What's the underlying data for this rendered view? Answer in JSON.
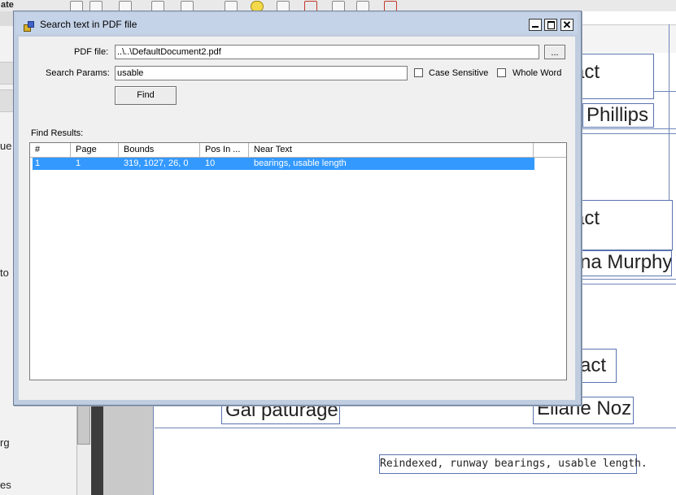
{
  "background": {
    "menu_fragment": "ate",
    "side_texts": [
      "ue",
      "to",
      "rg",
      "es"
    ],
    "cells": {
      "contact_1": "act",
      "name_1": "Phillips",
      "contact_2": "act",
      "name_2": "na Murphy",
      "contact_3": "act",
      "place": "Gal paturage",
      "name_3": "Eliane Noz"
    },
    "note": "Reindexed, runway bearings, usable length."
  },
  "dialog": {
    "title": "Search text in PDF file",
    "pdf_label": "PDF file:",
    "pdf_value": "..\\..\\DefaultDocument2.pdf",
    "browse_label": "...",
    "search_label": "Search Params:",
    "search_value": "usable",
    "case_sensitive_label": "Case Sensitive",
    "case_sensitive_checked": false,
    "whole_word_label": "Whole Word",
    "whole_word_checked": false,
    "find_label": "Find",
    "results_label": "Find Results:",
    "columns": [
      "#",
      "Page",
      "Bounds",
      "Pos In ...",
      "Near Text"
    ],
    "rows": [
      {
        "num": "1",
        "page": "1",
        "bounds": "319, 1027, 26, 0",
        "pos": "10",
        "near": "bearings, usable length"
      }
    ],
    "selection_color": "#3399ff"
  }
}
